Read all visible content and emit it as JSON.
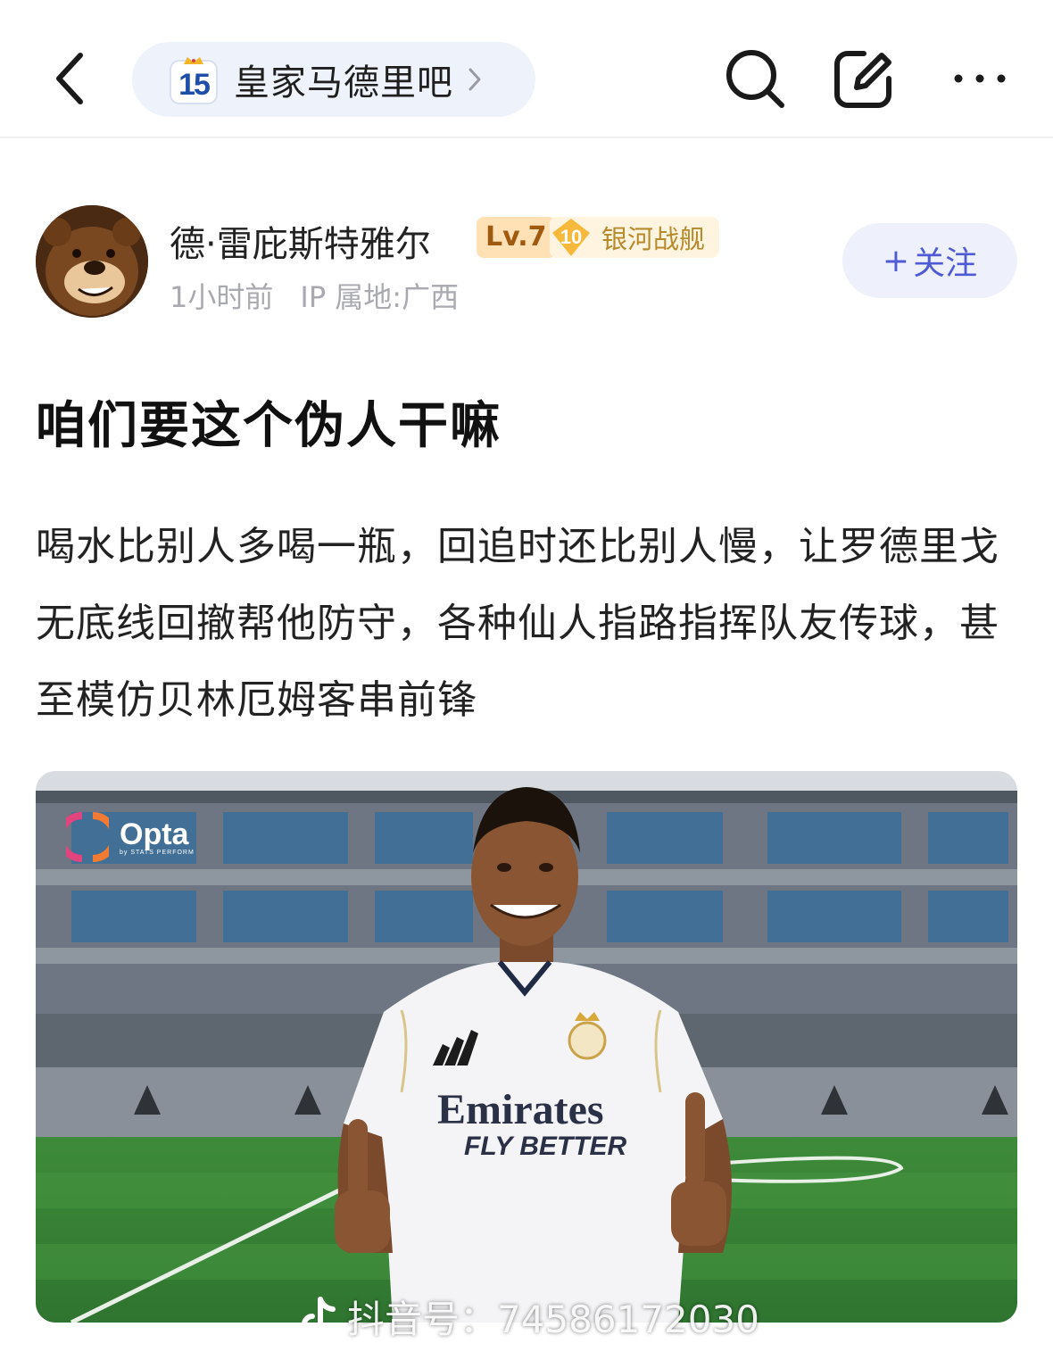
{
  "header": {
    "forum_name": "皇家马德里吧",
    "forum_badge_number": "15"
  },
  "author": {
    "name": "德·雷庇斯特雅尔",
    "level": "Lv.7",
    "rank_number": "10",
    "rank_title": "银河战舰",
    "time": "1小时前",
    "ip_location": "IP 属地:广西",
    "follow_label": "关注",
    "follow_plus": "+"
  },
  "post": {
    "title": "咱们要这个伪人干嘛",
    "body": "喝水比别人多喝一瓶，回追时还比别人慢，让罗德里戈无底线回撤帮他防守，各种仙人指路指挥队友传球，甚至模仿贝林厄姆客串前锋"
  },
  "image": {
    "logo_text": "Opta",
    "logo_subtext": "by STATS PERFORM",
    "jersey_sponsor": "Emirates",
    "jersey_slogan": "FLY BETTER",
    "watermark": "抖音号：74586172030"
  },
  "colors": {
    "accent": "#4e5bd4",
    "pill_bg": "#eef2fb",
    "meta_gray": "#a9a9b0",
    "level_bg": "#ffe1b5",
    "rank_gold": "#f6b93b"
  },
  "icons": {
    "back": "chevron-left-icon",
    "search": "search-icon",
    "edit": "edit-icon",
    "more": "more-icon"
  }
}
